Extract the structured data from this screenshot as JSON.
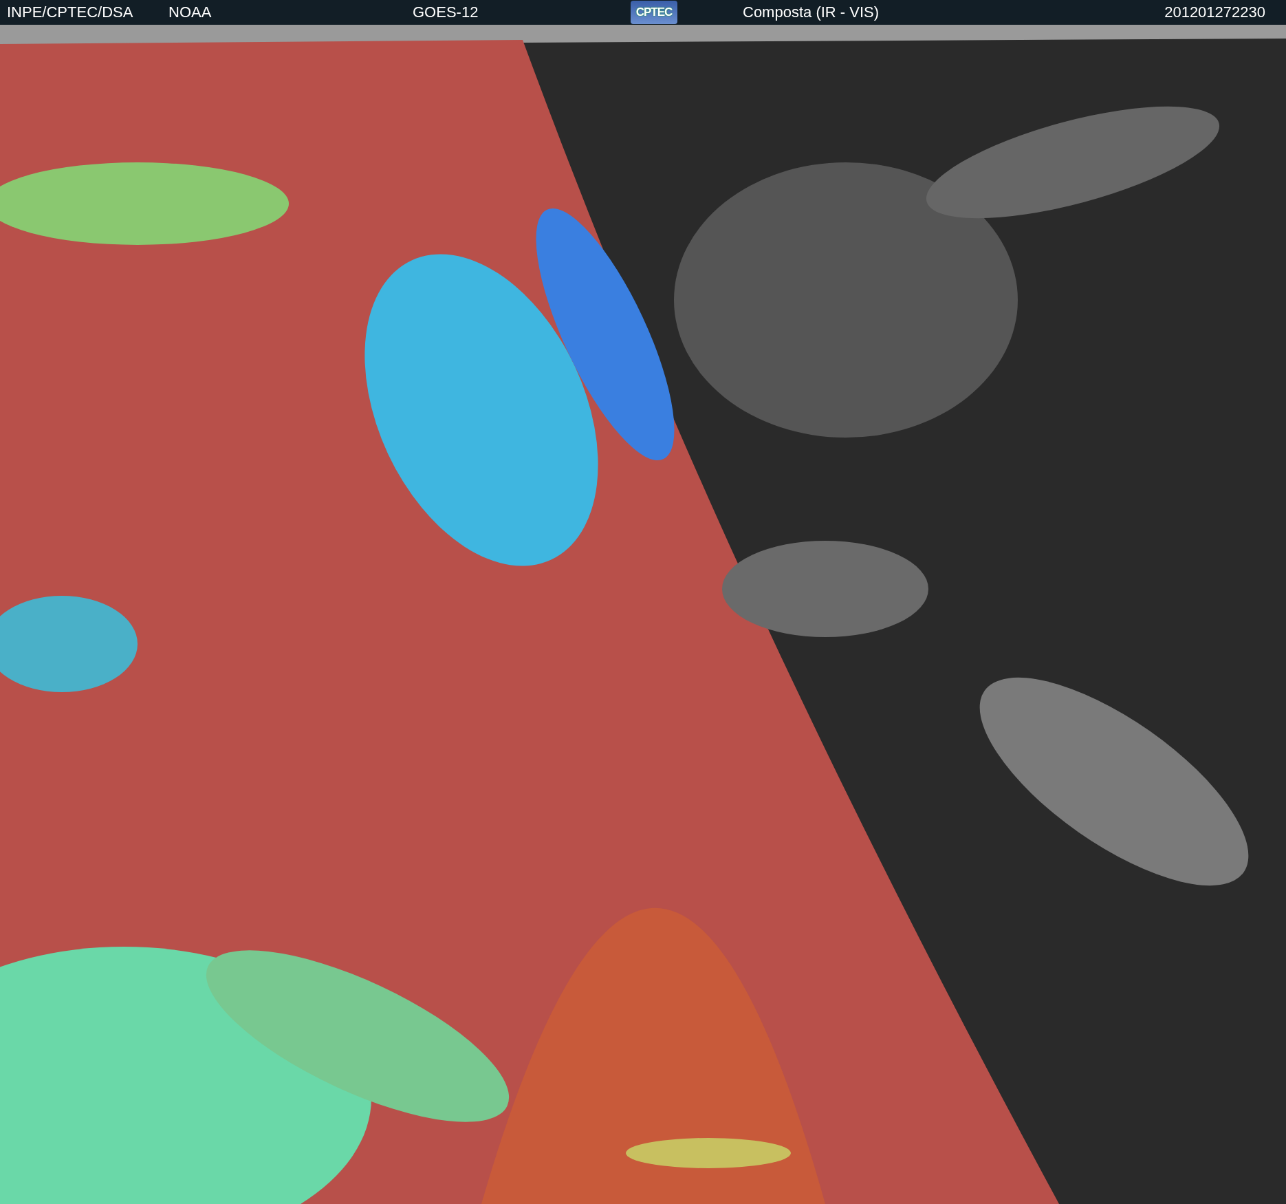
{
  "header": {
    "texts": [
      {
        "kind": "source",
        "text": "INPE/CPTEC/DSA"
      },
      {
        "kind": "agency",
        "text": "NOAA"
      },
      {
        "kind": "satellite",
        "text": "GOES-12"
      },
      {
        "kind": "logo",
        "text": "CPTEC"
      },
      {
        "kind": "product",
        "text": "Composta (IR - VIS)"
      },
      {
        "kind": "timestamp",
        "text": "201201272230"
      }
    ]
  }
}
